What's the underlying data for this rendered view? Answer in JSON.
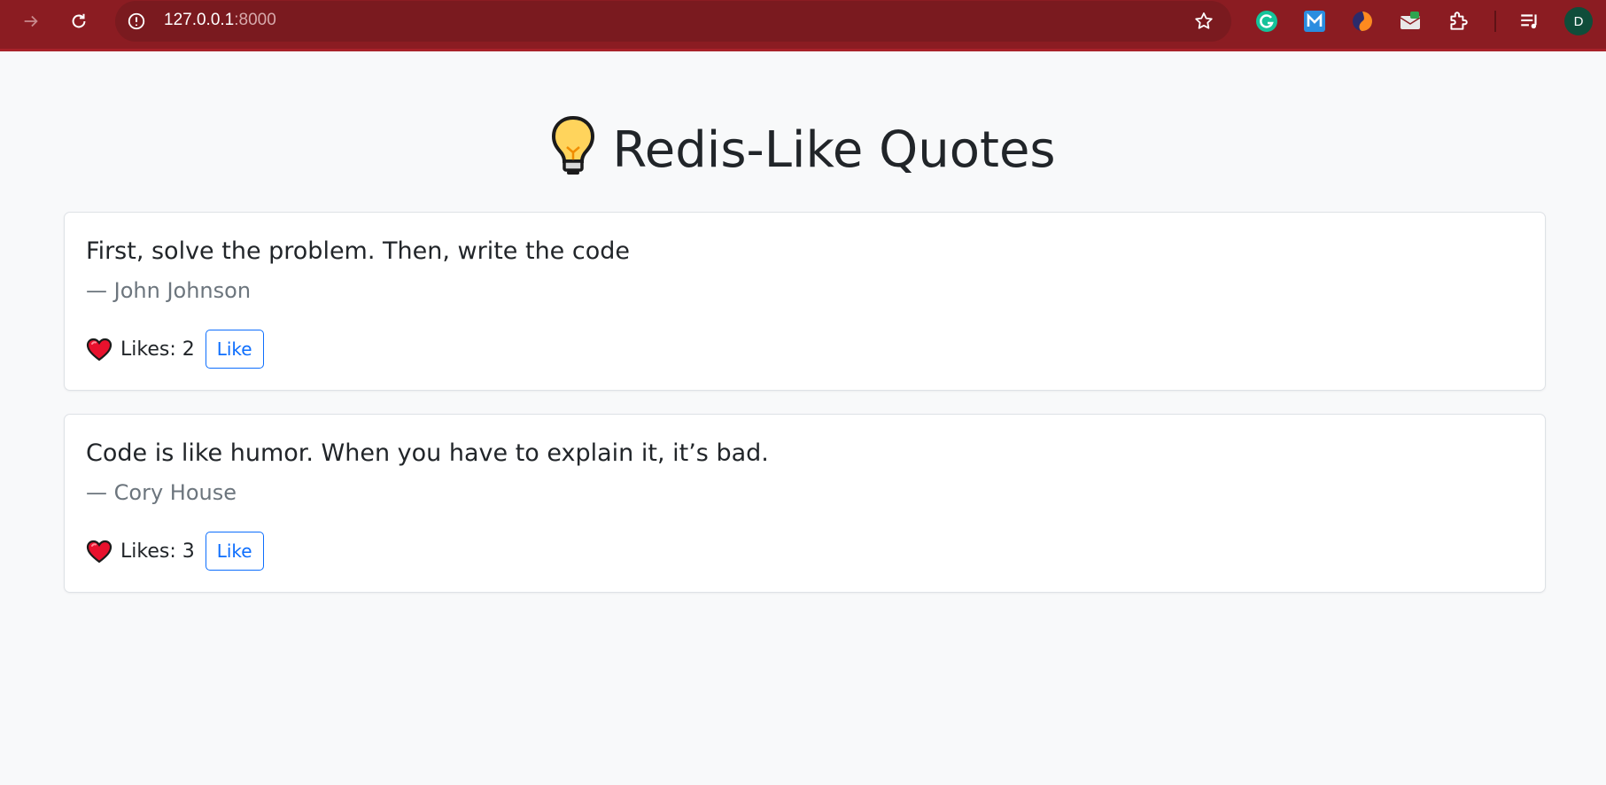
{
  "browser": {
    "url_host": "127.0.0.1",
    "url_port": ":8000",
    "avatar_letter": "D",
    "icons": [
      "forward-icon",
      "reload-icon",
      "site-info-icon",
      "bookmark-star-icon",
      "grammarly-icon",
      "m-extension-icon",
      "firefox-like-extension-icon",
      "mail-extension-icon",
      "extensions-puzzle-icon",
      "media-controls-icon"
    ],
    "colors": {
      "toolbar": "#8b1c22",
      "address_bar": "#7a1a1f"
    }
  },
  "page": {
    "title": "Redis-Like Quotes",
    "title_icon": "lightbulb-icon",
    "like_button_label": "Like",
    "likes_prefix": "Likes: ",
    "quotes": [
      {
        "text": "First, solve the problem. Then, write the code",
        "author": "— John Johnson",
        "likes": "2",
        "likes_label": "Likes: 2"
      },
      {
        "text": "Code is like humor. When you have to explain it, it’s bad.",
        "author": "— Cory House",
        "likes": "3",
        "likes_label": "Likes: 3"
      }
    ],
    "colors": {
      "accent": "#0d6efd",
      "text": "#212529",
      "muted": "#6c757d",
      "background": "#f8f9fa"
    }
  }
}
